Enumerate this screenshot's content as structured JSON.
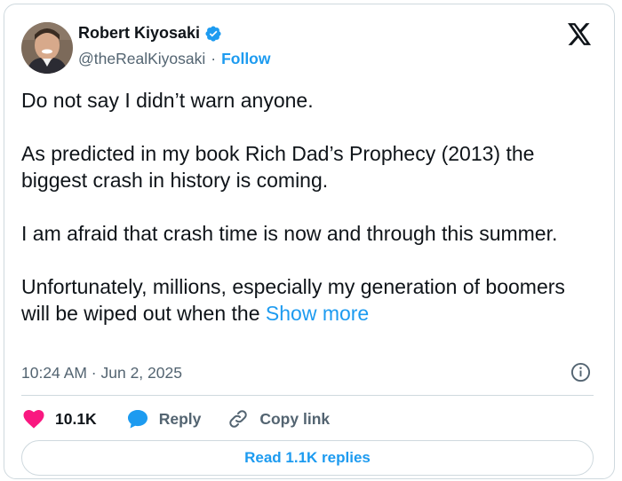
{
  "author": {
    "name": "Robert Kiyosaki",
    "handle": "@theRealKiyosaki",
    "separator": "·",
    "follow_label": "Follow",
    "verified_color": "#1d9bf0"
  },
  "tweet": {
    "paragraphs": [
      "Do not say I didn’t warn anyone.",
      "As predicted in my book Rich Dad’s Prophecy (2013) the biggest crash in history is coming.",
      "I am afraid that crash time is now and through this summer.",
      "Unfortunately, millions, especially my generation of boomers will be wiped out when the"
    ],
    "show_more_label": "Show more",
    "timestamp": "10:24 AM · Jun 2, 2025"
  },
  "actions": {
    "likes": "10.1K",
    "reply_label": "Reply",
    "copy_link_label": "Copy link",
    "read_replies_label": "Read 1.1K replies"
  },
  "icons": {
    "logo": "x-logo-icon",
    "info": "info-icon",
    "like": "heart-icon",
    "reply": "speech-bubble-icon",
    "link": "link-icon"
  },
  "colors": {
    "accent": "#1d9bf0",
    "like": "#f91880",
    "muted": "#536471",
    "text": "#0f1419",
    "border": "#cfd9de"
  }
}
